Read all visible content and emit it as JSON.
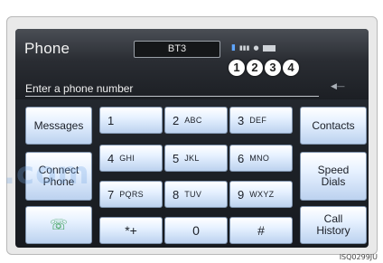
{
  "header": {
    "title": "Phone",
    "device_name": "BT3",
    "phone_slots": [
      "1",
      "2",
      "3",
      "4"
    ]
  },
  "input": {
    "placeholder": "Enter a phone number"
  },
  "left_buttons": [
    {
      "label": "Messages"
    },
    {
      "label": "Connect\nPhone"
    },
    {
      "icon": "phone-call-icon"
    }
  ],
  "keypad": [
    {
      "digit": "1",
      "letters": ""
    },
    {
      "digit": "2",
      "letters": "ABC"
    },
    {
      "digit": "3",
      "letters": "DEF"
    },
    {
      "digit": "4",
      "letters": "GHI"
    },
    {
      "digit": "5",
      "letters": "JKL"
    },
    {
      "digit": "6",
      "letters": "MNO"
    },
    {
      "digit": "7",
      "letters": "PQRS"
    },
    {
      "digit": "8",
      "letters": "TUV"
    },
    {
      "digit": "9",
      "letters": "WXYZ"
    },
    {
      "digit": "*+",
      "letters": ""
    },
    {
      "digit": "0",
      "letters": ""
    },
    {
      "digit": "#",
      "letters": ""
    }
  ],
  "right_buttons": [
    {
      "label": "Contacts"
    },
    {
      "label": "Speed\nDials"
    },
    {
      "label": "Call\nHistory"
    }
  ],
  "figure_code": "ISQ0299JU",
  "watermark_text": ".com"
}
